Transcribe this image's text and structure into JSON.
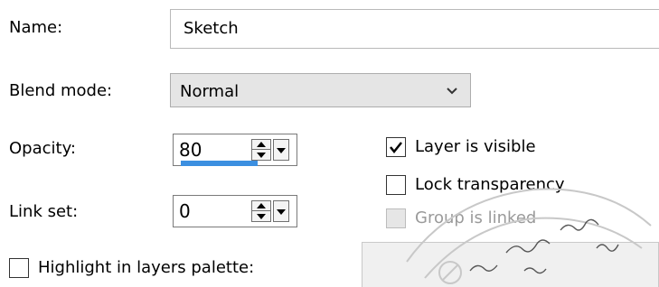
{
  "dialog": {
    "name": {
      "label": "Name:",
      "value": "Sketch"
    },
    "blend_mode": {
      "label": "Blend mode:",
      "value": "Normal"
    },
    "opacity": {
      "label": "Opacity:",
      "value": "80",
      "level_fraction": 0.8
    },
    "link_set": {
      "label": "Link set:",
      "value": "0"
    },
    "checkboxes": {
      "layer_visible": {
        "label": "Layer is visible",
        "checked": true,
        "enabled": true
      },
      "lock_transparency": {
        "label": "Lock transparency",
        "checked": false,
        "enabled": true
      },
      "group_linked": {
        "label": "Group is linked",
        "checked": false,
        "enabled": false
      },
      "highlight": {
        "label": "Highlight in layers palette:",
        "checked": false,
        "enabled": true
      }
    },
    "icons": {
      "blend_dropdown": "chevron-down-icon",
      "checkmark": "checkmark-icon",
      "spin": "spin-updown-icon",
      "spin_drop": "dropdown-arrow-icon"
    },
    "colors": {
      "accent": "#3c8fe0",
      "disabled_text": "#9a9a9a",
      "control_bg": "#e5e5e5"
    }
  }
}
